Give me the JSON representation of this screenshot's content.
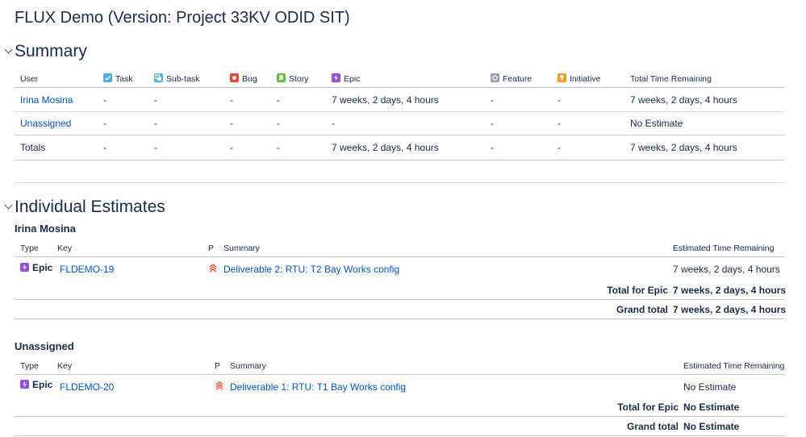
{
  "page": {
    "title": "FLUX Demo (Version: Project 33KV ODID SIT)"
  },
  "summary": {
    "heading": "Summary",
    "columns": {
      "user": "User",
      "task": "Task",
      "subtask": "Sub-task",
      "bug": "Bug",
      "story": "Story",
      "epic": "Epic",
      "feature": "Feature",
      "initiative": "Initiative",
      "total": "Total Time Remaining"
    },
    "rows": [
      {
        "user": "Irina Mosina",
        "task": "-",
        "subtask": "-",
        "bug": "-",
        "story": "-",
        "epic": "7 weeks, 2 days, 4 hours",
        "feature": "-",
        "initiative": "-",
        "total": "7 weeks, 2 days, 4 hours"
      },
      {
        "user": "Unassigned",
        "task": "-",
        "subtask": "-",
        "bug": "-",
        "story": "-",
        "epic": "-",
        "feature": "-",
        "initiative": "-",
        "total": "No Estimate"
      },
      {
        "user": "Totals",
        "task": "-",
        "subtask": "-",
        "bug": "-",
        "story": "-",
        "epic": "7 weeks, 2 days, 4 hours",
        "feature": "-",
        "initiative": "-",
        "total": "7 weeks, 2 days, 4 hours"
      }
    ]
  },
  "individual": {
    "heading": "Individual Estimates",
    "columns": {
      "type": "Type",
      "key": "Key",
      "p": "P",
      "summary": "Summary",
      "estimate": "Estimated Time Remaining"
    },
    "sections": [
      {
        "user": "Irina Mosina",
        "row": {
          "type": "Epic",
          "key": "FLDEMO-19",
          "summary": "Deliverable 2: RTU: T2 Bay Works config",
          "estimate": "7 weeks, 2 days, 4 hours"
        },
        "total_label": "Total for Epic",
        "total_value": "7 weeks, 2 days, 4 hours",
        "grand_label": "Grand total",
        "grand_value": "7 weeks, 2 days, 4 hours"
      },
      {
        "user": "Unassigned",
        "row": {
          "type": "Epic",
          "key": "FLDEMO-20",
          "summary": "Deliverable 1: RTU: T1 Bay Works config",
          "estimate": "No Estimate"
        },
        "total_label": "Total for Epic",
        "total_value": "No Estimate",
        "grand_label": "Grand total",
        "grand_value": "No Estimate"
      }
    ]
  },
  "icons": {
    "task": "task-icon",
    "subtask": "subtask-icon",
    "bug": "bug-icon",
    "story": "story-icon",
    "epic": "epic-icon",
    "feature": "feature-icon",
    "initiative": "initiative-icon",
    "priority": "priority-highest-icon"
  },
  "colors": {
    "task": "#4bade8",
    "subtask": "#4bade8",
    "bug": "#e5493a",
    "story": "#63ba3c",
    "epic": "#904ee2",
    "feature": "#97a0af",
    "initiative": "#ff991f",
    "priority": "#ff5630",
    "link": "#0052cc"
  }
}
